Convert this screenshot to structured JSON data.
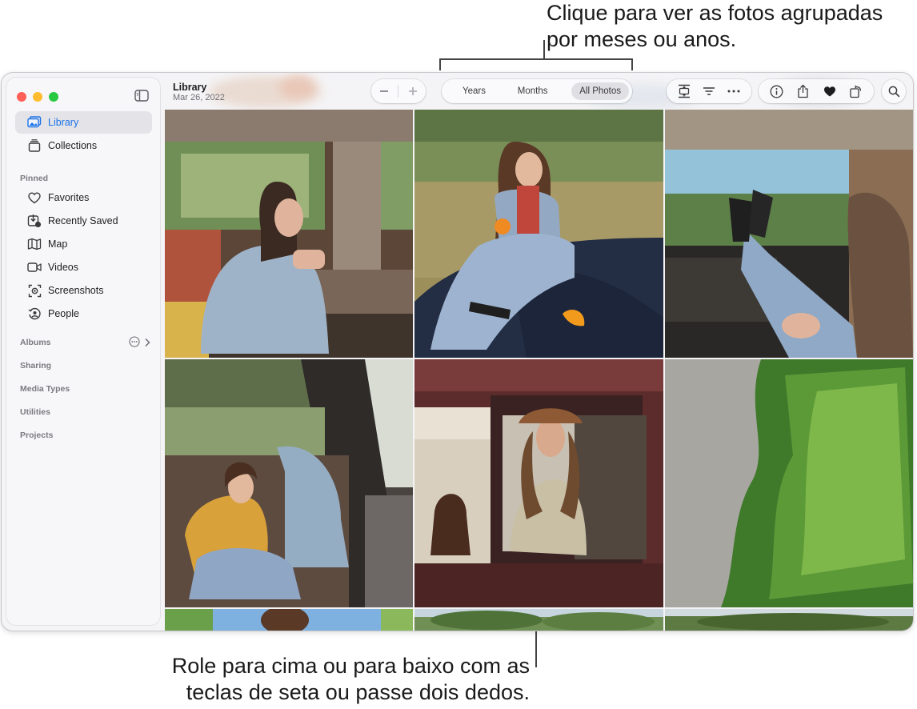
{
  "callouts": {
    "top": "Clique para ver as fotos agrupadas por meses ou anos.",
    "bottom": "Role para cima ou para baixo com as teclas de seta ou passe dois dedos."
  },
  "sidebar": {
    "items": [
      {
        "label": "Library",
        "icon": "library-icon",
        "selected": true
      },
      {
        "label": "Collections",
        "icon": "collections-icon"
      }
    ],
    "pinned_header": "Pinned",
    "pinned": [
      {
        "label": "Favorites",
        "icon": "heart-icon"
      },
      {
        "label": "Recently Saved",
        "icon": "recently-saved-icon"
      },
      {
        "label": "Map",
        "icon": "map-icon"
      },
      {
        "label": "Videos",
        "icon": "video-icon"
      },
      {
        "label": "Screenshots",
        "icon": "screenshot-icon"
      },
      {
        "label": "People",
        "icon": "people-icon"
      }
    ],
    "sections": [
      "Albums",
      "Sharing",
      "Media Types",
      "Utilities",
      "Projects"
    ]
  },
  "toolbar": {
    "title": "Library",
    "date": "Mar 26, 2022",
    "segments": [
      "Years",
      "Months",
      "All Photos"
    ],
    "active_segment": "All Photos"
  },
  "colors": {
    "accent": "#1a73e8",
    "traffic_red": "#ff5f57",
    "traffic_yellow": "#febc2e",
    "traffic_green": "#28c840"
  }
}
